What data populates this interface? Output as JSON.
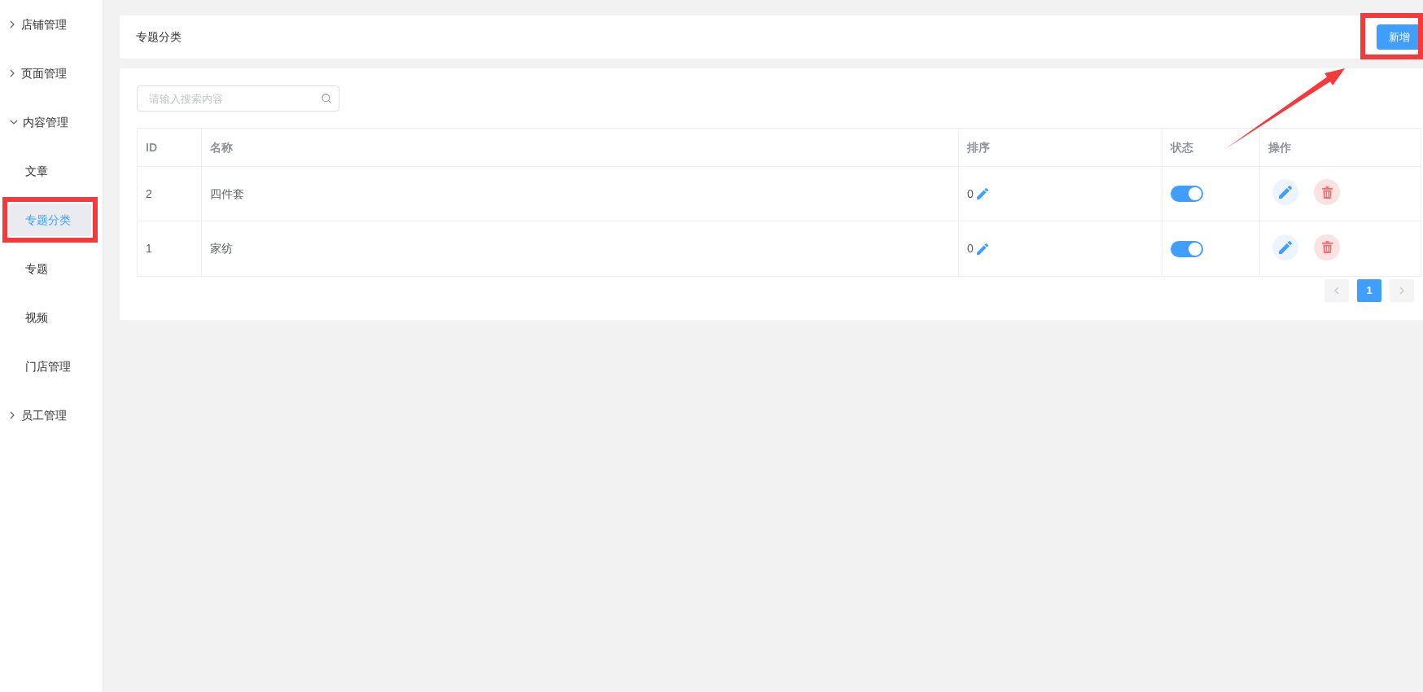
{
  "sidebar": {
    "items": [
      {
        "label": "店铺管理",
        "expanded": false
      },
      {
        "label": "页面管理",
        "expanded": false
      },
      {
        "label": "内容管理",
        "expanded": true,
        "children": [
          {
            "label": "文章",
            "selected": false,
            "highlighted": false
          },
          {
            "label": "专题分类",
            "selected": true,
            "highlighted": true
          },
          {
            "label": "专题",
            "selected": false,
            "highlighted": false
          },
          {
            "label": "视频",
            "selected": false,
            "highlighted": false
          },
          {
            "label": "门店管理",
            "selected": false,
            "highlighted": false
          }
        ]
      },
      {
        "label": "员工管理",
        "expanded": false
      }
    ]
  },
  "header": {
    "title": "专题分类",
    "button": {
      "label": "新增",
      "highlighted": true,
      "pointed_at": true
    }
  },
  "search": {
    "placeholder": "请输入搜索内容"
  },
  "table": {
    "columns": [
      "ID",
      "名称",
      "排序",
      "状态",
      "操作"
    ],
    "rows": [
      {
        "id": "2",
        "name": "四件套",
        "sort": "0",
        "enabled": true
      },
      {
        "id": "1",
        "name": "家纺",
        "sort": "0",
        "enabled": true
      }
    ]
  },
  "pagination": {
    "prev_disabled": true,
    "next_disabled": true,
    "pages": [
      {
        "label": "1",
        "selected": true
      }
    ]
  }
}
